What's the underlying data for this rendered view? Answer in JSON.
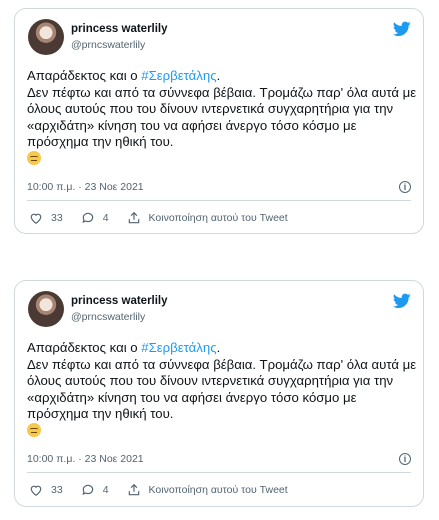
{
  "tweets": [
    {
      "display_name": "princess waterlily",
      "handle": "@prncswaterlily",
      "text_before_tag": "Απαράδεκτος και ο ",
      "hashtag": "#Σερβετάλης",
      "text_after_tag": ".\nΔεν πέφτω και από τα σύννεφα βέβαια. Τρομάζω παρ' όλα αυτά με όλους αυτούς που του δίνουν ιντερνετικά συγχαρητήρια για την «αρχιδάτη» κίνηση του να αφήσει άνεργο τόσο κόσμο με πρόσχημα την ηθική του.\n",
      "timestamp": "10:00 π.μ. · 23 Νοε 2021",
      "likes": "33",
      "replies": "4",
      "share_label": "Κοινοποίηση αυτού του Tweet"
    },
    {
      "display_name": "princess waterlily",
      "handle": "@prncswaterlily",
      "text_before_tag": "Απαράδεκτος και ο ",
      "hashtag": "#Σερβετάλης",
      "text_after_tag": ".\nΔεν πέφτω και από τα σύννεφα βέβαια. Τρομάζω παρ' όλα αυτά με όλους αυτούς που του δίνουν ιντερνετικά συγχαρητήρια για την «αρχιδάτη» κίνηση του να αφήσει άνεργο τόσο κόσμο με πρόσχημα την ηθική του.\n",
      "timestamp": "10:00 π.μ. · 23 Νοε 2021",
      "likes": "33",
      "replies": "4",
      "share_label": "Κοινοποίηση αυτού του Tweet"
    }
  ],
  "icons": [
    "twitter-bird-icon",
    "info-icon",
    "heart-icon",
    "reply-icon",
    "share-icon",
    "unamused-face-emoji"
  ],
  "colors": {
    "accent": "#1d9bf0",
    "text": "#0f1419",
    "muted": "#536471",
    "border": "#cfd9de"
  }
}
